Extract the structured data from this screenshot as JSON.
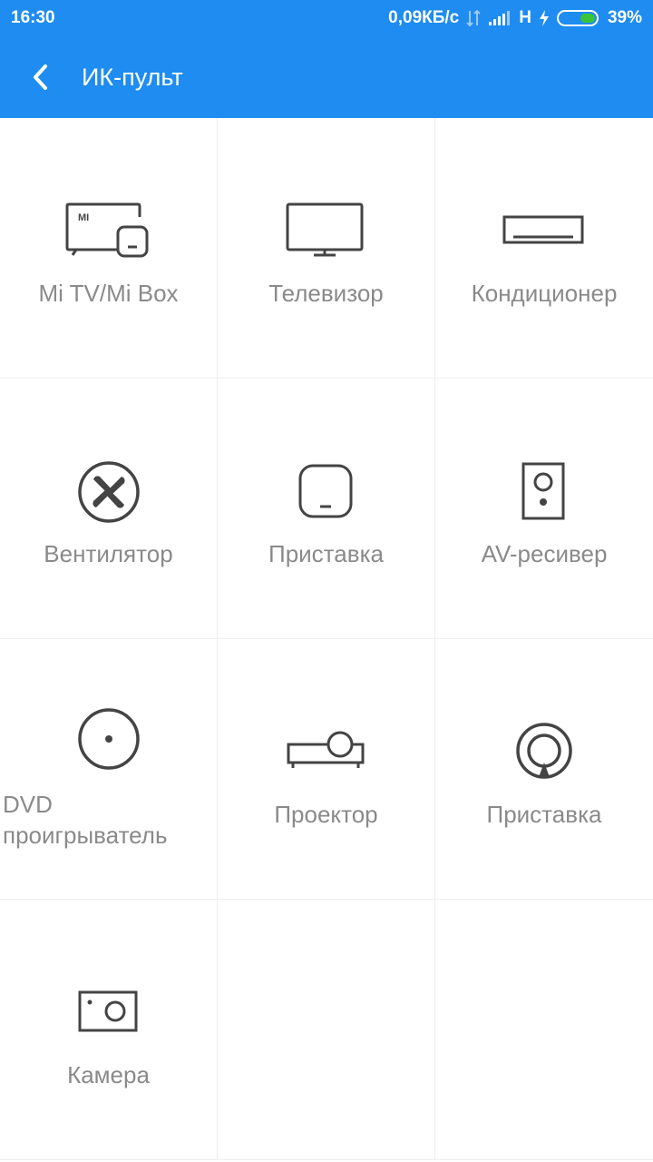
{
  "statusbar": {
    "time": "16:30",
    "speed": "0,09КБ/с",
    "network": "H",
    "battery": "39%"
  },
  "appbar": {
    "title": "ИК-пульт",
    "back_icon": "chevron-left-icon"
  },
  "colors": {
    "header": "#1e8cf0",
    "label": "#8a8a8a",
    "icon": "#444444",
    "battery_fill": "#3bc43b"
  },
  "devices": [
    {
      "label": "Mi TV/Mi Box",
      "icon": "mi-tv-box-icon"
    },
    {
      "label": "Телевизор",
      "icon": "tv-icon"
    },
    {
      "label": "Кондиционер",
      "icon": "air-conditioner-icon"
    },
    {
      "label": "Вентилятор",
      "icon": "fan-icon"
    },
    {
      "label": "Приставка",
      "icon": "set-top-box-icon"
    },
    {
      "label": "AV-ресивер",
      "icon": "speaker-icon"
    },
    {
      "label": "DVD проигрыватель",
      "icon": "disc-icon"
    },
    {
      "label": "Проектор",
      "icon": "projector-icon"
    },
    {
      "label": "Приставка",
      "icon": "satellite-box-icon"
    },
    {
      "label": "Камера",
      "icon": "camera-icon"
    }
  ]
}
